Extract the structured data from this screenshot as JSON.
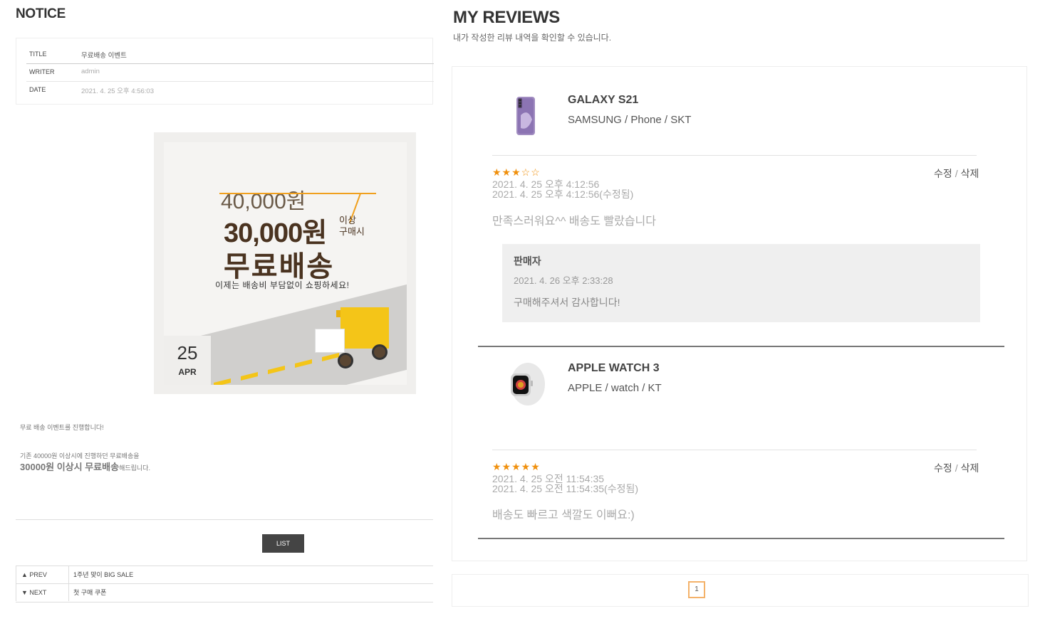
{
  "notice": {
    "heading": "NOTICE",
    "info": [
      {
        "key": "TITLE",
        "value": "무료배송 이벤트"
      },
      {
        "key": "WRITER",
        "value": "admin"
      },
      {
        "key": "DATE",
        "value": "2021. 4. 25 오후 4:56:03"
      }
    ],
    "banner": {
      "old_price": "40,000원",
      "new_price": "30,000원",
      "side_1": "이상",
      "side_2": "구매시",
      "headline": "무료배송",
      "subline": "이제는 배송비 부담없이 쇼핑하세요!",
      "day": "25",
      "month": "APR"
    },
    "content": {
      "line1": "무료 배송 이벤트를 진행합니다!",
      "line2": "기존 40000원 이상시에 진행하던 무료배송을",
      "line3_bold": "30000원 이상시 무료배송",
      "line3_tail": "해드립니다."
    },
    "list_button": "LIST",
    "prev": {
      "label": "▲ PREV",
      "title": "1주년 맞이 BIG SALE"
    },
    "next": {
      "label": "▼ NEXT",
      "title": "첫 구매 쿠폰"
    }
  },
  "reviews": {
    "heading": "MY REVIEWS",
    "subtitle": "내가 작성한 리뷰 내역을 확인할 수 있습니다.",
    "items": [
      {
        "product_name": "GALAXY S21",
        "product_meta": "SAMSUNG / Phone / SKT",
        "stars": "★★★☆☆",
        "rating": 3,
        "date": "2021. 4. 25 오후 4:12:56",
        "edited_date": "2021. 4. 25 오후 4:12:56(수정됨)",
        "text": "만족스러워요^^ 배송도 빨랐습니다",
        "edit": "수정",
        "sep": "/",
        "delete": "삭제",
        "reply": {
          "who": "판매자",
          "date": "2021. 4. 26 오후 2:33:28",
          "text": "구매해주셔서 감사합니다!"
        }
      },
      {
        "product_name": "APPLE WATCH 3",
        "product_meta": "APPLE / watch / KT",
        "stars": "★★★★★",
        "rating": 5,
        "date": "2021. 4. 25 오전 11:54:35",
        "edited_date": "2021. 4. 25 오전 11:54:35(수정됨)",
        "text": "배송도 빠르고 색깔도 이뻐요:)",
        "edit": "수정",
        "sep": "/",
        "delete": "삭제"
      }
    ],
    "pagination": {
      "current": "1"
    }
  },
  "colors": {
    "star": "#f0900d",
    "page_border": "#f4b26a",
    "banner_yellow": "#f4c518",
    "banner_brown": "#4a3320"
  }
}
